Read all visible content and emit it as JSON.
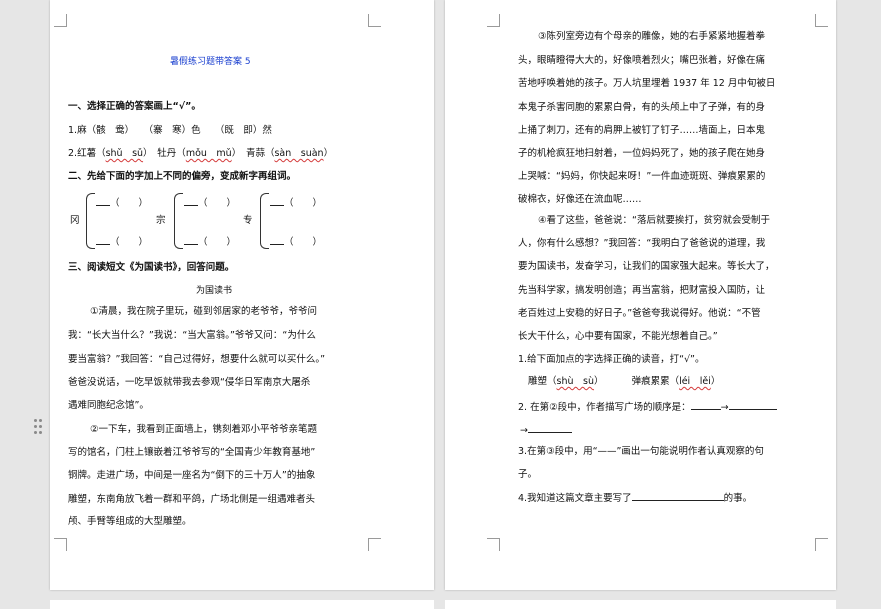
{
  "page1": {
    "title": "暑假练习题带答案 5",
    "section1_heading": "一、选择正确的答案画上“√”。",
    "q1": "1.麻（骸　鸯）　　（寨　寒）色　　（既　即）然",
    "q2_prefix": "2.红薯（",
    "q2_p1": "shǔ　sǔ",
    "q2_mid1": "）　牡丹（",
    "q2_p2": "mǒu　mǔ",
    "q2_mid2": "）　青蒜（",
    "q2_p3": "sàn　suàn",
    "q2_suffix": "）",
    "section2_heading": "二、先给下面的字加上不同的偏旁，变成新字再组词。",
    "char1": "冈",
    "char2": "宗",
    "char3": "专",
    "paren": "（　　）",
    "section3_heading": "三、阅读短文《为国读书》，回答问题。",
    "article_title": "为国读书",
    "paragraphs": [
      "①清晨，我在院子里玩，碰到邻居家的老爷爷，爷爷问",
      "我：“长大当什么？”我说：“当大富翁。”爷爷又问：“为什么",
      "要当富翁？”我回答：“自己过得好，想要什么就可以买什么。”",
      "爸爸没说话，一吃早饭就带我去参观“侵华日军南京大屠杀",
      "遇难同胞纪念馆”。",
      "②一下车，我看到正面墙上，镌刻着邓小平爷爷亲笔题",
      "写的馆名，门柱上镶嵌着江爷爷写的“全国青少年教育基地”",
      "铜牌。走进广场，中间是一座名为“倒下的三十万人”的抽象",
      "雕塑，东南角放飞着一群和平鸽，广场北侧是一组遇难者头",
      "颅、手臂等组成的大型雕塑。"
    ]
  },
  "page2": {
    "paragraphs": [
      "③陈列室旁边有个母亲的雕像，她的右手紧紧地握着拳",
      "头，眼睛瞪得大大的，好像喷着烈火；嘴巴张着，好像在痛",
      "苦地呼唤着她的孩子。万人坑里埋着 1937 年 12 月中旬被日",
      "本鬼子杀害同胞的累累白骨，有的头颅上中了子弹，有的身",
      "上捅了刺刀，还有的肩胛上被钉了钉子……墙面上，日本鬼",
      "子的机枪疯狂地扫射着，一位妈妈死了，她的孩子爬在她身",
      "上哭喊：“妈妈，你快起来呀！”一件血迹斑斑、弹痕累累的",
      "破棉衣，好像还在流血呢……",
      "④看了这些，爸爸说：“落后就要挨打，贫穷就会受制于",
      "人，你有什么感想？”我回答：“我明白了爸爸说的道理，我",
      "要为国读书，发奋学习，让我们的国家强大起来。等长大了，",
      "先当科学家，搞发明创造；再当富翁，把财富投入国防，让",
      "老百姓过上安稳的好日子。”爸爸夸我说得好。他说：“不管",
      "长大干什么，心中要有国家，不能光想着自己。”"
    ],
    "q1": "1.给下面加点的字选择正确的读音，打“√”。",
    "q1_w1": "雕塑（",
    "q1_w1p": "shù　sù",
    "q1_w1s": "）",
    "q1_w2": "弹痕累累（",
    "q1_w2p": "léi　lěi",
    "q1_w2s": "）",
    "q2": "2. 在第②段中，作者描写广场的顺序是：",
    "arrow": "→",
    "q3a": "3.在第③段中，用“——”画出一句能说明作者认真观察的句",
    "q3b": "子。",
    "q4a": "4.我知道这篇文章主要写了",
    "q4b": "的事。"
  }
}
